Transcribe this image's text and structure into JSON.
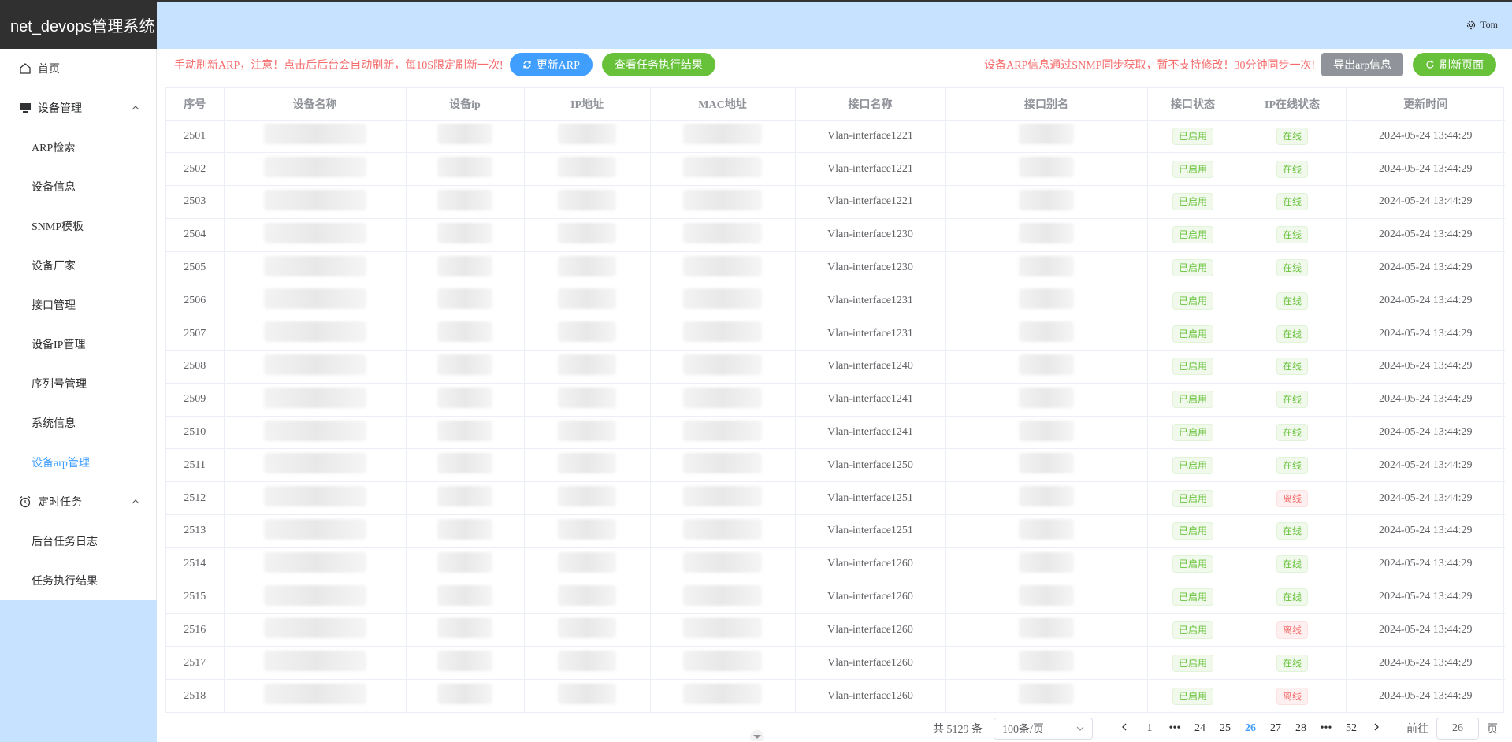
{
  "app": {
    "title": "net_devops管理系统"
  },
  "header": {
    "user_name": "Tom"
  },
  "sidebar": {
    "home": "首页",
    "device_mgmt": "设备管理",
    "device_sub": [
      "ARP检索",
      "设备信息",
      "SNMP模板",
      "设备厂家",
      "接口管理",
      "设备IP管理",
      "序列号管理",
      "系统信息",
      "设备arp管理"
    ],
    "timed_tasks": "定时任务",
    "task_sub": [
      "后台任务日志",
      "任务执行结果"
    ]
  },
  "toolbar": {
    "left_notice": "手动刷新ARP，注意！点击后后台会自动刷新，每10S限定刷新一次!",
    "update_arp": "更新ARP",
    "view_results": "查看任务执行结果",
    "right_notice": "设备ARP信息通过SNMP同步获取，暂不支持修改！30分钟同步一次!",
    "export": "导出arp信息",
    "refresh": "刷新页面"
  },
  "table": {
    "columns": [
      "序号",
      "设备名称",
      "设备ip",
      "IP地址",
      "MAC地址",
      "接口名称",
      "接口别名",
      "接口状态",
      "IP在线状态",
      "更新时间"
    ],
    "rows": [
      {
        "id": "2501",
        "iface": "Vlan-interface1221",
        "status": "已启用",
        "online": "在线",
        "time": "2024-05-24 13:44:29"
      },
      {
        "id": "2502",
        "iface": "Vlan-interface1221",
        "status": "已启用",
        "online": "在线",
        "time": "2024-05-24 13:44:29"
      },
      {
        "id": "2503",
        "iface": "Vlan-interface1221",
        "status": "已启用",
        "online": "在线",
        "time": "2024-05-24 13:44:29"
      },
      {
        "id": "2504",
        "iface": "Vlan-interface1230",
        "status": "已启用",
        "online": "在线",
        "time": "2024-05-24 13:44:29"
      },
      {
        "id": "2505",
        "iface": "Vlan-interface1230",
        "status": "已启用",
        "online": "在线",
        "time": "2024-05-24 13:44:29"
      },
      {
        "id": "2506",
        "iface": "Vlan-interface1231",
        "status": "已启用",
        "online": "在线",
        "time": "2024-05-24 13:44:29"
      },
      {
        "id": "2507",
        "iface": "Vlan-interface1231",
        "status": "已启用",
        "online": "在线",
        "time": "2024-05-24 13:44:29"
      },
      {
        "id": "2508",
        "iface": "Vlan-interface1240",
        "status": "已启用",
        "online": "在线",
        "time": "2024-05-24 13:44:29"
      },
      {
        "id": "2509",
        "iface": "Vlan-interface1241",
        "status": "已启用",
        "online": "在线",
        "time": "2024-05-24 13:44:29"
      },
      {
        "id": "2510",
        "iface": "Vlan-interface1241",
        "status": "已启用",
        "online": "在线",
        "time": "2024-05-24 13:44:29"
      },
      {
        "id": "2511",
        "iface": "Vlan-interface1250",
        "status": "已启用",
        "online": "在线",
        "time": "2024-05-24 13:44:29"
      },
      {
        "id": "2512",
        "iface": "Vlan-interface1251",
        "status": "已启用",
        "online": "离线",
        "time": "2024-05-24 13:44:29"
      },
      {
        "id": "2513",
        "iface": "Vlan-interface1251",
        "status": "已启用",
        "online": "在线",
        "time": "2024-05-24 13:44:29"
      },
      {
        "id": "2514",
        "iface": "Vlan-interface1260",
        "status": "已启用",
        "online": "在线",
        "time": "2024-05-24 13:44:29"
      },
      {
        "id": "2515",
        "iface": "Vlan-interface1260",
        "status": "已启用",
        "online": "在线",
        "time": "2024-05-24 13:44:29"
      },
      {
        "id": "2516",
        "iface": "Vlan-interface1260",
        "status": "已启用",
        "online": "离线",
        "time": "2024-05-24 13:44:29"
      },
      {
        "id": "2517",
        "iface": "Vlan-interface1260",
        "status": "已启用",
        "online": "在线",
        "time": "2024-05-24 13:44:29"
      },
      {
        "id": "2518",
        "iface": "Vlan-interface1260",
        "status": "已启用",
        "online": "离线",
        "time": "2024-05-24 13:44:29"
      }
    ]
  },
  "pagination": {
    "total": "共 5129 条",
    "page_size": "100条/页",
    "pages": [
      "1",
      "•••",
      "24",
      "25",
      "26",
      "27",
      "28",
      "•••",
      "52"
    ],
    "current": "26",
    "goto_label": "前往",
    "goto_value": "26",
    "page_unit": "页"
  },
  "colors": {
    "accent": "#409eff",
    "success": "#67c23a",
    "danger": "#f56c6c",
    "header_bg": "#c6e2ff"
  },
  "icons": {
    "home": "home-icon",
    "monitor": "monitor-icon",
    "alarm": "alarm-clock-icon",
    "settings": "gear-icon",
    "refresh": "refresh-icon"
  }
}
